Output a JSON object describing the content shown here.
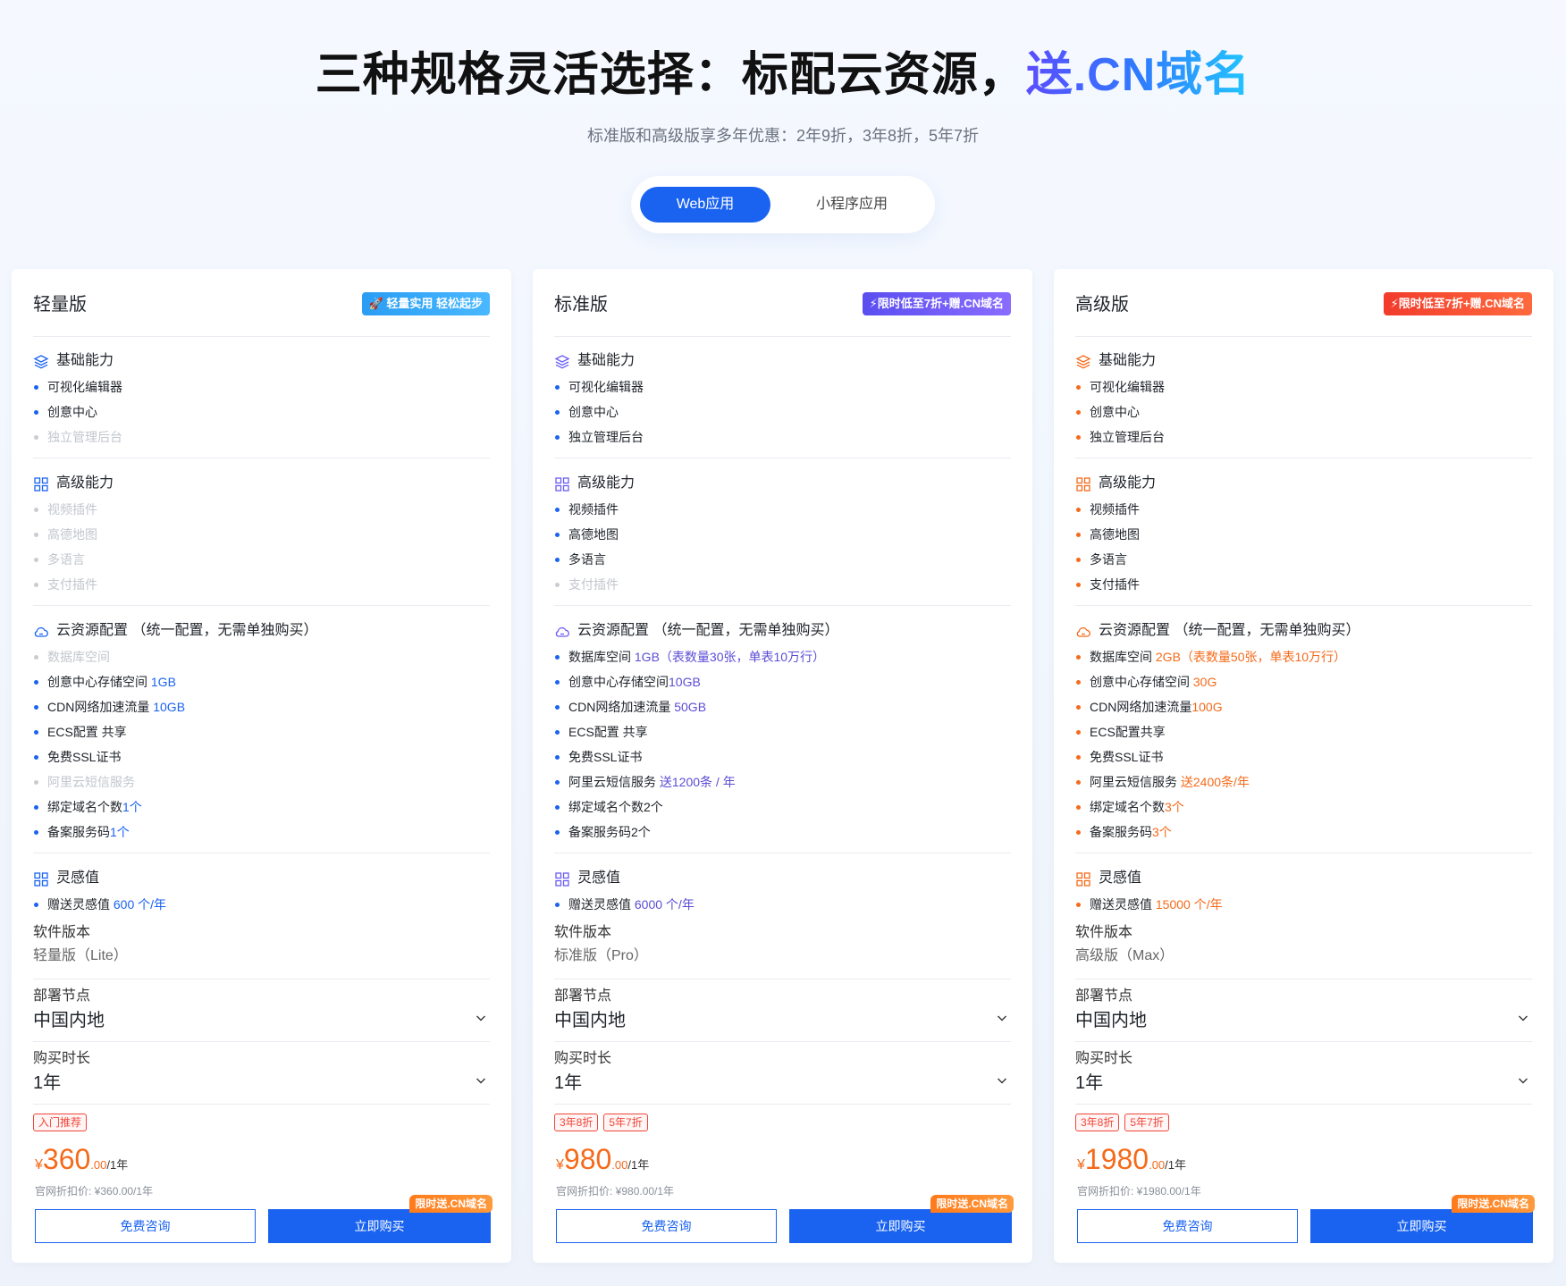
{
  "hero": {
    "title_main": "三种规格灵活选择：标配云资源，",
    "title_accent": "送.CN域名",
    "subtitle": "标准版和高级版享多年优惠：2年9折，3年8折，5年7折"
  },
  "tabs": [
    {
      "label": "Web应用",
      "active": true
    },
    {
      "label": "小程序应用",
      "active": false
    }
  ],
  "colors": {
    "primary": "#1a63f0",
    "orange": "#f56a1a",
    "purple": "#5b4dd6",
    "disabled": "#c2c6cc"
  },
  "icons": {
    "basic": "layers-icon",
    "advanced": "grid-icon",
    "cloud": "cloud-icon",
    "inspiration": "grid-icon",
    "chevron": "chevron-down-icon"
  },
  "section_titles": {
    "basic": "基础能力",
    "advanced": "高级能力",
    "cloud": "云资源配置 （统一配置，无需单独购买）",
    "inspiration": "灵感值",
    "version_label": "软件版本",
    "node_label": "部署节点",
    "duration_label": "购买时长"
  },
  "cards": [
    {
      "name": "轻量版",
      "tag": "🚀 轻量实用 轻松起步",
      "basic": [
        {
          "text": "可视化编辑器",
          "hl": "",
          "on": true
        },
        {
          "text": "创意中心",
          "hl": "",
          "on": true
        },
        {
          "text": "独立管理后台",
          "hl": "",
          "on": false
        }
      ],
      "advanced": [
        {
          "text": "视频插件",
          "hl": "",
          "on": false
        },
        {
          "text": "高德地图",
          "hl": "",
          "on": false
        },
        {
          "text": "多语言",
          "hl": "",
          "on": false
        },
        {
          "text": "支付插件",
          "hl": "",
          "on": false
        }
      ],
      "cloud": [
        {
          "text": "数据库空间",
          "hl": "",
          "on": false
        },
        {
          "text": "创意中心存储空间 ",
          "hl": "1GB",
          "on": true
        },
        {
          "text": "CDN网络加速流量 ",
          "hl": "10GB",
          "on": true
        },
        {
          "text": "ECS配置 共享",
          "hl": "",
          "on": true
        },
        {
          "text": "免费SSL证书",
          "hl": "",
          "on": true
        },
        {
          "text": "阿里云短信服务",
          "hl": "",
          "on": false
        },
        {
          "text": "绑定域名个数",
          "hl": "1个",
          "on": true
        },
        {
          "text": "备案服务码",
          "hl": "1个",
          "on": true
        }
      ],
      "inspiration": {
        "text": "赠送灵感值 ",
        "hl": "600 个/年"
      },
      "version": "轻量版（Lite）",
      "node": "中国内地",
      "duration": "1年",
      "badges": [
        "入门推荐"
      ],
      "price": {
        "currency": "¥",
        "integer": "360",
        "decimal": ".00",
        "unit": "/1年"
      },
      "original_price": "官网折扣价: ¥360.00/1年",
      "consult_label": "免费咨询",
      "buy_label": "立即购买",
      "ribbon": "限时送.CN域名"
    },
    {
      "name": "标准版",
      "tag": "⚡限时低至7折+赠.CN域名",
      "basic": [
        {
          "text": "可视化编辑器",
          "hl": "",
          "on": true
        },
        {
          "text": "创意中心",
          "hl": "",
          "on": true
        },
        {
          "text": "独立管理后台",
          "hl": "",
          "on": true
        }
      ],
      "advanced": [
        {
          "text": "视频插件",
          "hl": "",
          "on": true
        },
        {
          "text": "高德地图",
          "hl": "",
          "on": true
        },
        {
          "text": "多语言",
          "hl": "",
          "on": true
        },
        {
          "text": "支付插件",
          "hl": "",
          "on": false
        }
      ],
      "cloud": [
        {
          "text": "数据库空间 ",
          "hl": "1GB（表数量30张，单表10万行）",
          "on": true
        },
        {
          "text": "创意中心存储空间",
          "hl": "10GB",
          "on": true
        },
        {
          "text": "CDN网络加速流量 ",
          "hl": "50GB",
          "on": true
        },
        {
          "text": "ECS配置 共享",
          "hl": "",
          "on": true
        },
        {
          "text": "免费SSL证书",
          "hl": "",
          "on": true
        },
        {
          "text": "阿里云短信服务 ",
          "hl": "送1200条 / 年",
          "on": true
        },
        {
          "text": "绑定域名个数2个",
          "hl": "",
          "on": true
        },
        {
          "text": "备案服务码2个",
          "hl": "",
          "on": true
        }
      ],
      "inspiration": {
        "text": "赠送灵感值 ",
        "hl": "6000 个/年"
      },
      "version": "标准版（Pro）",
      "node": "中国内地",
      "duration": "1年",
      "badges": [
        "3年8折",
        "5年7折"
      ],
      "price": {
        "currency": "¥",
        "integer": "980",
        "decimal": ".00",
        "unit": "/1年"
      },
      "original_price": "官网折扣价: ¥980.00/1年",
      "consult_label": "免费咨询",
      "buy_label": "立即购买",
      "ribbon": "限时送.CN域名"
    },
    {
      "name": "高级版",
      "tag": "⚡限时低至7折+赠.CN域名",
      "basic": [
        {
          "text": "可视化编辑器",
          "hl": "",
          "on": true
        },
        {
          "text": "创意中心",
          "hl": "",
          "on": true
        },
        {
          "text": "独立管理后台",
          "hl": "",
          "on": true
        }
      ],
      "advanced": [
        {
          "text": "视频插件",
          "hl": "",
          "on": true
        },
        {
          "text": "高德地图",
          "hl": "",
          "on": true
        },
        {
          "text": "多语言",
          "hl": "",
          "on": true
        },
        {
          "text": "支付插件",
          "hl": "",
          "on": true
        }
      ],
      "cloud": [
        {
          "text": "数据库空间 ",
          "hl": "2GB（表数量50张，单表10万行）",
          "on": true
        },
        {
          "text": "创意中心存储空间 ",
          "hl": "30G",
          "on": true
        },
        {
          "text": "CDN网络加速流量",
          "hl": "100G",
          "on": true
        },
        {
          "text": "ECS配置共享",
          "hl": "",
          "on": true
        },
        {
          "text": "免费SSL证书",
          "hl": "",
          "on": true
        },
        {
          "text": "阿里云短信服务 ",
          "hl": "送2400条/年",
          "on": true
        },
        {
          "text": "绑定域名个数",
          "hl": "3个",
          "on": true
        },
        {
          "text": "备案服务码",
          "hl": "3个",
          "on": true
        }
      ],
      "inspiration": {
        "text": "赠送灵感值 ",
        "hl": "15000 个/年"
      },
      "version": "高级版（Max）",
      "node": "中国内地",
      "duration": "1年",
      "badges": [
        "3年8折",
        "5年7折"
      ],
      "price": {
        "currency": "¥",
        "integer": "1980",
        "decimal": ".00",
        "unit": "/1年"
      },
      "original_price": "官网折扣价: ¥1980.00/1年",
      "consult_label": "免费咨询",
      "buy_label": "立即购买",
      "ribbon": "限时送.CN域名"
    }
  ]
}
